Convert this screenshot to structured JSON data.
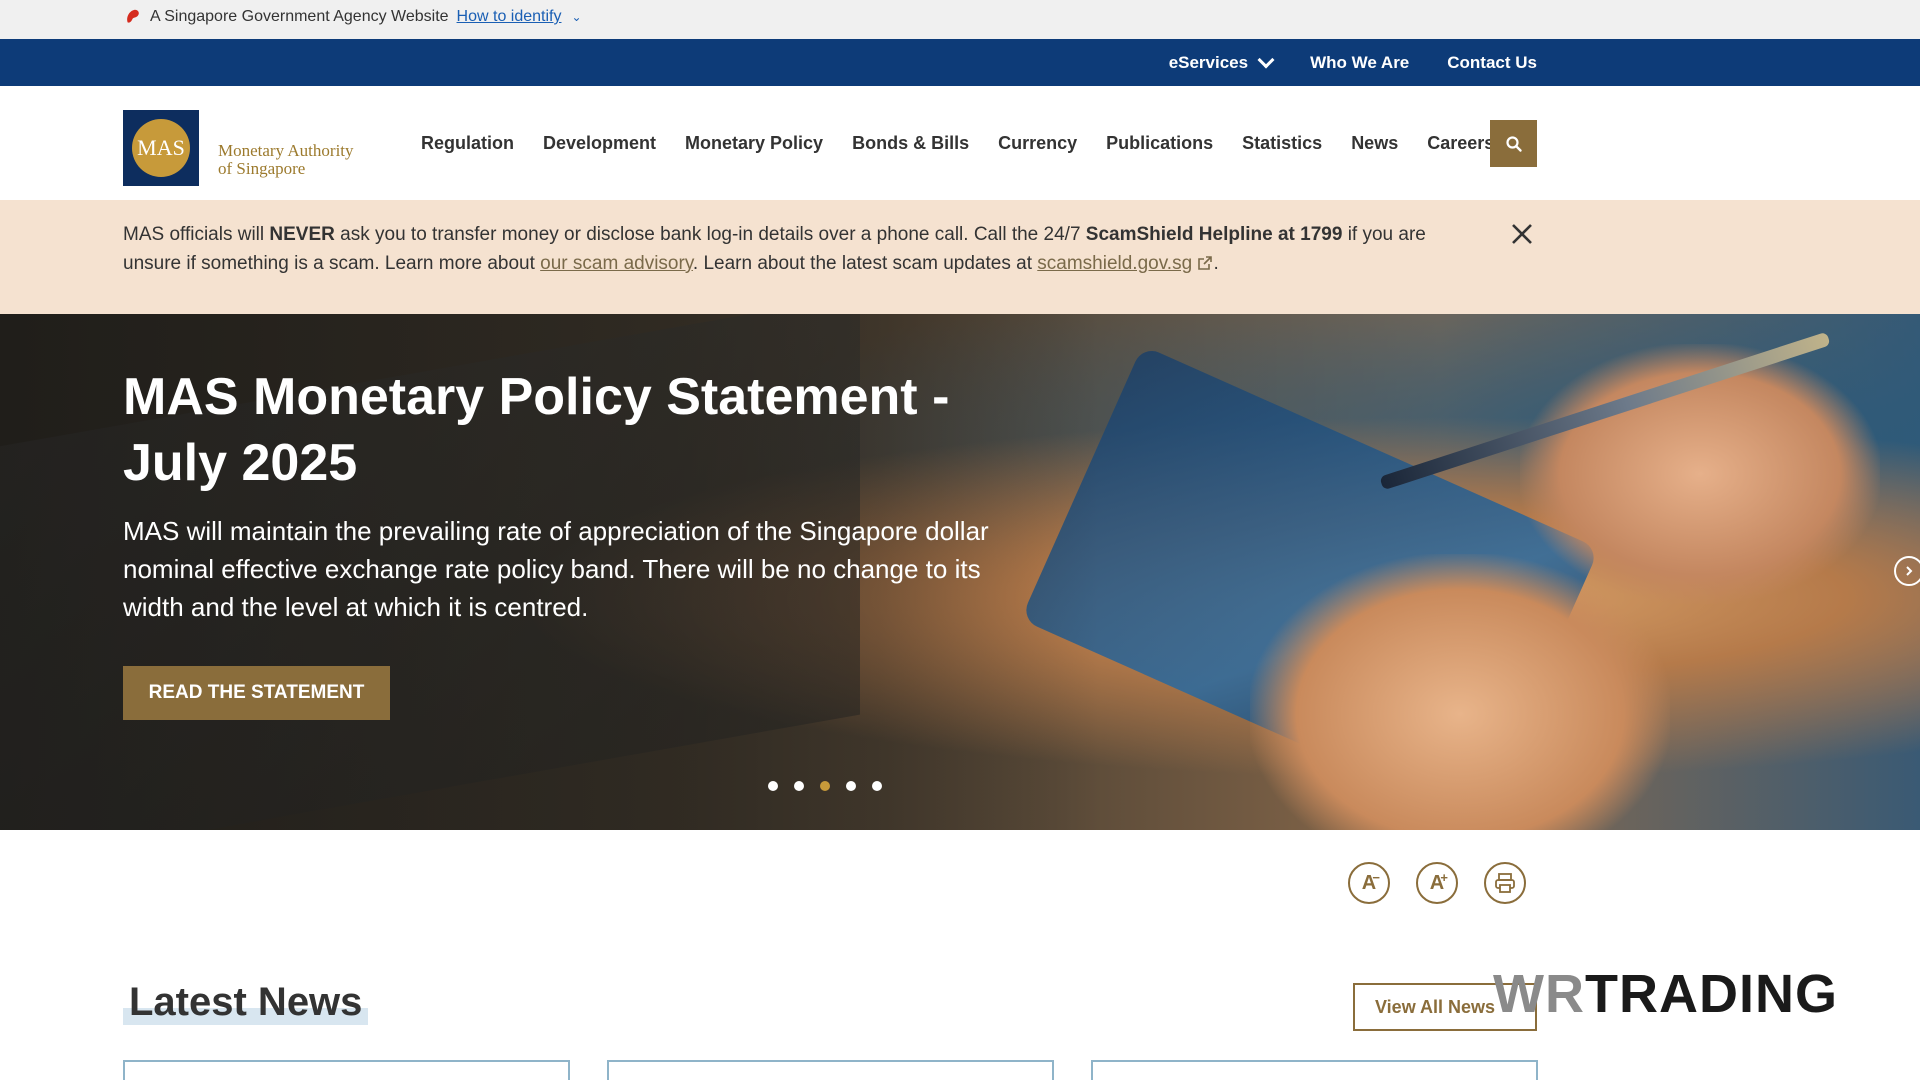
{
  "gov_banner": {
    "text": "A Singapore Government Agency Website",
    "link": "How to identify"
  },
  "utility_nav": {
    "items": [
      "eServices",
      "Who We Are",
      "Contact Us"
    ]
  },
  "header": {
    "logo_mark": "MAS",
    "logo_line1": "Monetary Authority",
    "logo_line2": "of Singapore",
    "nav": [
      "Regulation",
      "Development",
      "Monetary Policy",
      "Bonds & Bills",
      "Currency",
      "Publications",
      "Statistics",
      "News",
      "Careers"
    ]
  },
  "scam_banner": {
    "p1": "MAS officials will ",
    "b1": "NEVER",
    "p2": " ask you to transfer money or disclose bank log-in details over a phone call. Call the 24/7 ",
    "b2": "ScamShield Helpline at 1799",
    "p3": " if you are unsure if something is a scam. Learn more about ",
    "link1": "our scam advisory",
    "p4": ". Learn about the latest scam updates at ",
    "link2": "scamshield.gov.sg",
    "p5": "."
  },
  "hero": {
    "title": "MAS Monetary Policy Statement - July 2025",
    "body": "MAS will maintain the prevailing rate of appreciation of the Singapore dollar nominal effective exchange rate policy band. There will be no change to its width and the level at which it is centred.",
    "cta": "READ THE STATEMENT",
    "slide_count": 5,
    "active_slide": 3
  },
  "tools": {
    "decrease": "A",
    "increase": "A"
  },
  "latest_news": {
    "title": "Latest News",
    "view_all": "View All News"
  },
  "watermark": {
    "wr": "WR",
    "trading": "TRADING"
  },
  "colors": {
    "navy": "#0d3b78",
    "gold": "#8a6d3b",
    "banner": "#f5e2d0"
  }
}
